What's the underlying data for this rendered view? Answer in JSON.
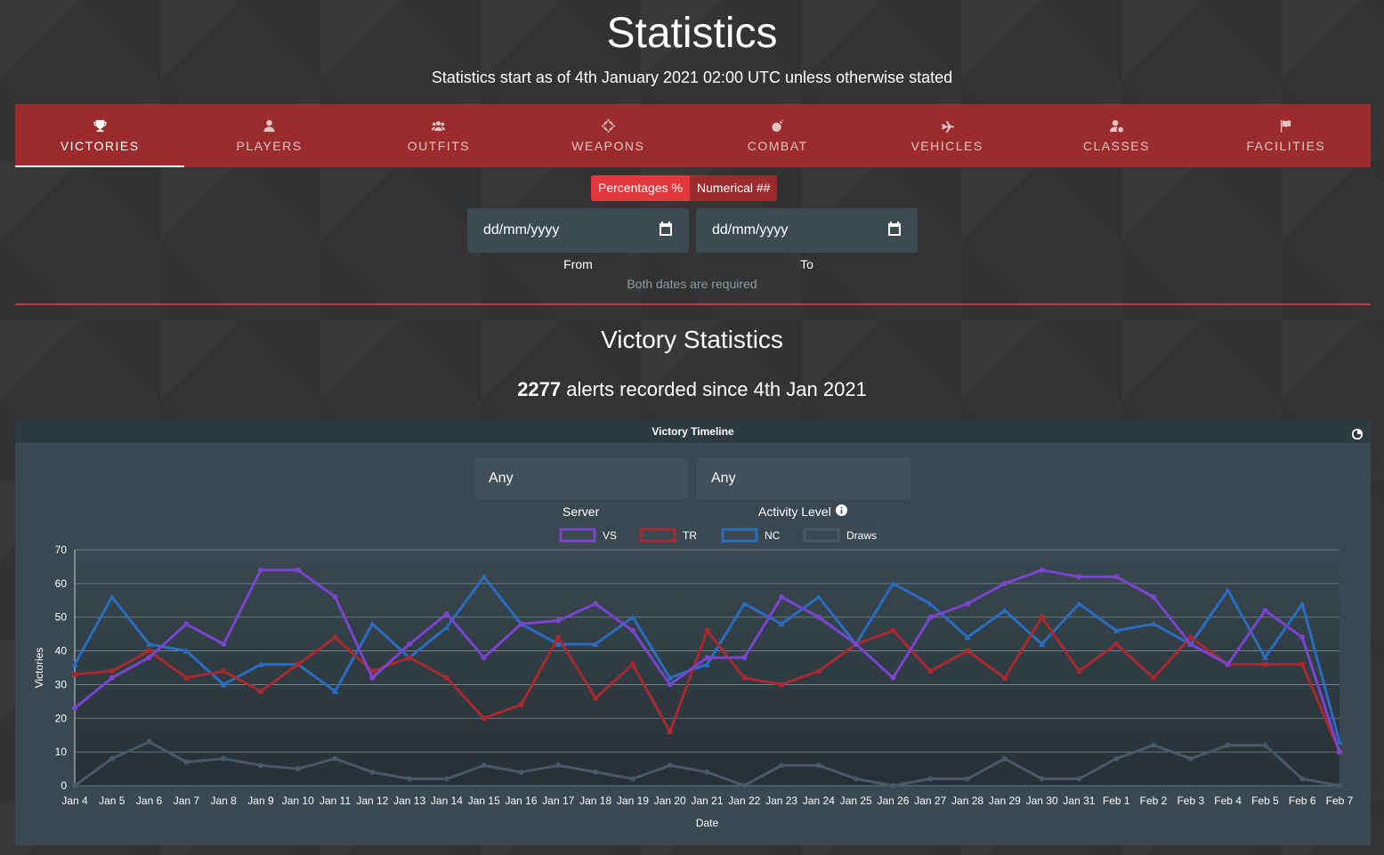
{
  "page": {
    "title": "Statistics",
    "subtitle": "Statistics start as of 4th January 2021 02:00 UTC unless otherwise stated"
  },
  "tabs": [
    {
      "label": "VICTORIES",
      "icon": "trophy-icon",
      "active": true
    },
    {
      "label": "PLAYERS",
      "icon": "user-icon",
      "active": false
    },
    {
      "label": "OUTFITS",
      "icon": "users-icon",
      "active": false
    },
    {
      "label": "WEAPONS",
      "icon": "crosshair-icon",
      "active": false
    },
    {
      "label": "COMBAT",
      "icon": "bomb-icon",
      "active": false
    },
    {
      "label": "VEHICLES",
      "icon": "plane-icon",
      "active": false
    },
    {
      "label": "CLASSES",
      "icon": "user-cog-icon",
      "active": false
    },
    {
      "label": "FACILITIES",
      "icon": "flag-icon",
      "active": false
    }
  ],
  "mode_toggle": {
    "percentages": "Percentages %",
    "numerical": "Numerical ##",
    "selected": "percentages"
  },
  "date_range": {
    "from_value": "dd/mm/yyyy",
    "from_label": "From",
    "to_value": "dd/mm/yyyy",
    "to_label": "To",
    "hint": "Both dates are required"
  },
  "section": {
    "title": "Victory Statistics",
    "alerts_count": "2277",
    "alerts_text": "alerts recorded since 4th Jan 2021"
  },
  "chart_card": {
    "title": "Victory Timeline",
    "server_value": "Any",
    "server_label": "Server",
    "activity_value": "Any",
    "activity_label": "Activity Level"
  },
  "colors": {
    "vs": "#7a44cf",
    "tr": "#a8292e",
    "nc": "#2a6cbf",
    "draws": "#4a5868",
    "accent": "#e2383d"
  },
  "chart_data": {
    "type": "line",
    "title": "Victory Timeline",
    "xlabel": "Date",
    "ylabel": "Victories",
    "ylim": [
      0,
      70
    ],
    "yticks": [
      0,
      10,
      20,
      30,
      40,
      50,
      60,
      70
    ],
    "grid": true,
    "legend": "top-center",
    "categories": [
      "Jan 4",
      "Jan 5",
      "Jan 6",
      "Jan 7",
      "Jan 8",
      "Jan 9",
      "Jan 10",
      "Jan 11",
      "Jan 12",
      "Jan 13",
      "Jan 14",
      "Jan 15",
      "Jan 16",
      "Jan 17",
      "Jan 18",
      "Jan 19",
      "Jan 20",
      "Jan 21",
      "Jan 22",
      "Jan 23",
      "Jan 24",
      "Jan 25",
      "Jan 26",
      "Jan 27",
      "Jan 28",
      "Jan 29",
      "Jan 30",
      "Jan 31",
      "Feb 1",
      "Feb 2",
      "Feb 3",
      "Feb 4",
      "Feb 5",
      "Feb 6",
      "Feb 7"
    ],
    "series": [
      {
        "name": "VS",
        "color": "#7a44cf",
        "values": [
          23,
          32,
          38,
          48,
          42,
          64,
          64,
          56,
          32,
          42,
          51,
          38,
          48,
          49,
          54,
          46,
          30,
          38,
          38,
          56,
          50,
          42,
          32,
          50,
          54,
          60,
          64,
          62,
          62,
          56,
          42,
          36,
          52,
          44,
          10
        ]
      },
      {
        "name": "TR",
        "color": "#a8292e",
        "values": [
          33,
          34,
          40,
          32,
          34,
          28,
          36,
          44,
          34,
          38,
          32,
          20,
          24,
          44,
          26,
          36,
          16,
          46,
          32,
          30,
          34,
          42,
          46,
          34,
          40,
          32,
          50,
          34,
          42,
          32,
          44,
          36,
          36,
          36,
          10
        ]
      },
      {
        "name": "NC",
        "color": "#2a6cbf",
        "values": [
          36,
          56,
          42,
          40,
          30,
          36,
          36,
          28,
          48,
          38,
          47,
          62,
          48,
          42,
          42,
          50,
          32,
          36,
          54,
          48,
          56,
          42,
          60,
          54,
          44,
          52,
          42,
          54,
          46,
          48,
          42,
          58,
          38,
          54,
          13
        ]
      },
      {
        "name": "Draws",
        "color": "#4a5868",
        "values": [
          0,
          8,
          13,
          7,
          8,
          6,
          5,
          8,
          4,
          2,
          2,
          6,
          4,
          6,
          4,
          2,
          6,
          4,
          0,
          6,
          6,
          2,
          0,
          2,
          2,
          8,
          2,
          2,
          8,
          12,
          8,
          12,
          12,
          2,
          0
        ]
      }
    ]
  }
}
